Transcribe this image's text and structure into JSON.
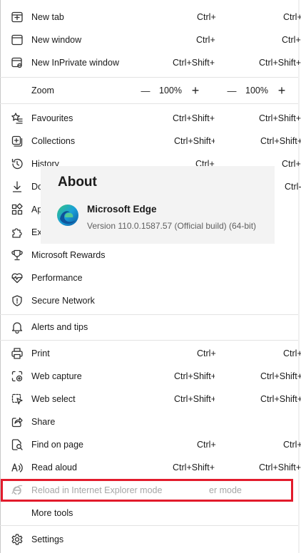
{
  "menu": {
    "new_tab": {
      "label": "New tab",
      "shortcut": "Ctrl+",
      "shortcut2": "Ctrl+"
    },
    "new_window": {
      "label": "New window",
      "shortcut": "Ctrl+",
      "shortcut2": "Ctrl+"
    },
    "new_inprivate": {
      "label": "New InPrivate window",
      "shortcut": "Ctrl+Shift+",
      "shortcut2": "Ctrl+Shift+"
    },
    "zoom": {
      "label": "Zoom",
      "minus": "—",
      "value": "100%",
      "plus": "+",
      "minus2": "—",
      "value2": "100%",
      "plus2": "+"
    },
    "favourites": {
      "label": "Favourites",
      "shortcut": "Ctrl+Shift+",
      "shortcut2": "Ctrl+Shift+"
    },
    "collections": {
      "label": "Collections",
      "shortcut": "Ctrl+Shift+",
      "shortcut2": "Ctrl+Shift+"
    },
    "history": {
      "label": "History",
      "shortcut": "Ctrl+",
      "shortcut2": "Ctrl+"
    },
    "downloads": {
      "label": "Do",
      "shortcut2": "Ctrl-"
    },
    "apps": {
      "label": "Ap"
    },
    "extensions": {
      "label": "Ex"
    },
    "rewards": {
      "label": "Microsoft Rewards"
    },
    "performance": {
      "label": "Performance"
    },
    "secure_network": {
      "label": "Secure Network"
    },
    "alerts": {
      "label": "Alerts and tips"
    },
    "print": {
      "label": "Print",
      "shortcut": "Ctrl+",
      "shortcut2": "Ctrl+"
    },
    "web_capture": {
      "label": "Web capture",
      "shortcut": "Ctrl+Shift+",
      "shortcut2": "Ctrl+Shift+"
    },
    "web_select": {
      "label": "Web select",
      "shortcut": "Ctrl+Shift+",
      "shortcut2": "Ctrl+Shift+"
    },
    "share": {
      "label": "Share"
    },
    "find_on_page": {
      "label": "Find on page",
      "shortcut": "Ctrl+",
      "shortcut2": "Ctrl+"
    },
    "read_aloud": {
      "label": "Read aloud",
      "shortcut": "Ctrl+Shift+",
      "shortcut2": "Ctrl+Shift+"
    },
    "reload_ie": {
      "label": "Reload in Internet Explorer mode",
      "ghost": "er mode"
    },
    "more_tools": {
      "label": "More tools"
    },
    "settings": {
      "label": "Settings"
    }
  },
  "about": {
    "title": "About",
    "product": "Microsoft Edge",
    "version": "Version 110.0.1587.57 (Official build) (64-bit)"
  },
  "colors": {
    "highlight": "#e21b2c",
    "panel_bg": "#f3f3f3"
  }
}
